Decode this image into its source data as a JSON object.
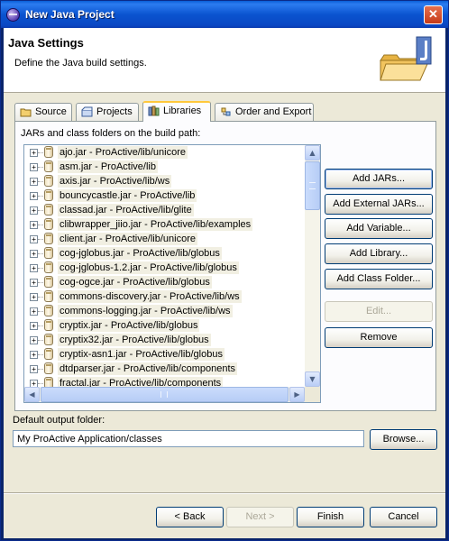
{
  "window": {
    "title": "New Java Project",
    "close_glyph": "✕"
  },
  "header": {
    "title": "Java Settings",
    "description": "Define the Java build settings."
  },
  "tabs": [
    {
      "label": "Source",
      "icon": "source-folder-icon"
    },
    {
      "label": "Projects",
      "icon": "projects-icon"
    },
    {
      "label": "Libraries",
      "icon": "libraries-icon",
      "active": true
    },
    {
      "label": "Order and Export",
      "icon": "order-export-icon"
    }
  ],
  "libraries": {
    "label": "JARs and class folders on the build path:",
    "items": [
      "ajo.jar - ProActive/lib/unicore",
      "asm.jar - ProActive/lib",
      "axis.jar - ProActive/lib/ws",
      "bouncycastle.jar - ProActive/lib",
      "classad.jar - ProActive/lib/glite",
      "clibwrapper_jiio.jar - ProActive/lib/examples",
      "client.jar - ProActive/lib/unicore",
      "cog-jglobus.jar - ProActive/lib/globus",
      "cog-jglobus-1.2.jar - ProActive/lib/globus",
      "cog-ogce.jar - ProActive/lib/globus",
      "commons-discovery.jar - ProActive/lib/ws",
      "commons-logging.jar - ProActive/lib/ws",
      "cryptix.jar - ProActive/lib/globus",
      "cryptix32.jar - ProActive/lib/globus",
      "cryptix-asn1.jar - ProActive/lib/globus",
      "dtdparser.jar - ProActive/lib/components",
      "fractal.jar - ProActive/lib/components"
    ],
    "expander_glyph": "+",
    "buttons": {
      "add_jars": "Add JARs...",
      "add_external_jars": "Add External JARs...",
      "add_variable": "Add Variable...",
      "add_library": "Add Library...",
      "add_class_folder": "Add Class Folder...",
      "edit": "Edit...",
      "remove": "Remove"
    }
  },
  "scroll": {
    "up": "▲",
    "down": "▼",
    "left": "◀",
    "right": "▶"
  },
  "output": {
    "label": "Default output folder:",
    "value": "My ProActive Application/classes",
    "browse": "Browse..."
  },
  "footer": {
    "back": "< Back",
    "next": "Next >",
    "finish": "Finish",
    "cancel": "Cancel"
  }
}
